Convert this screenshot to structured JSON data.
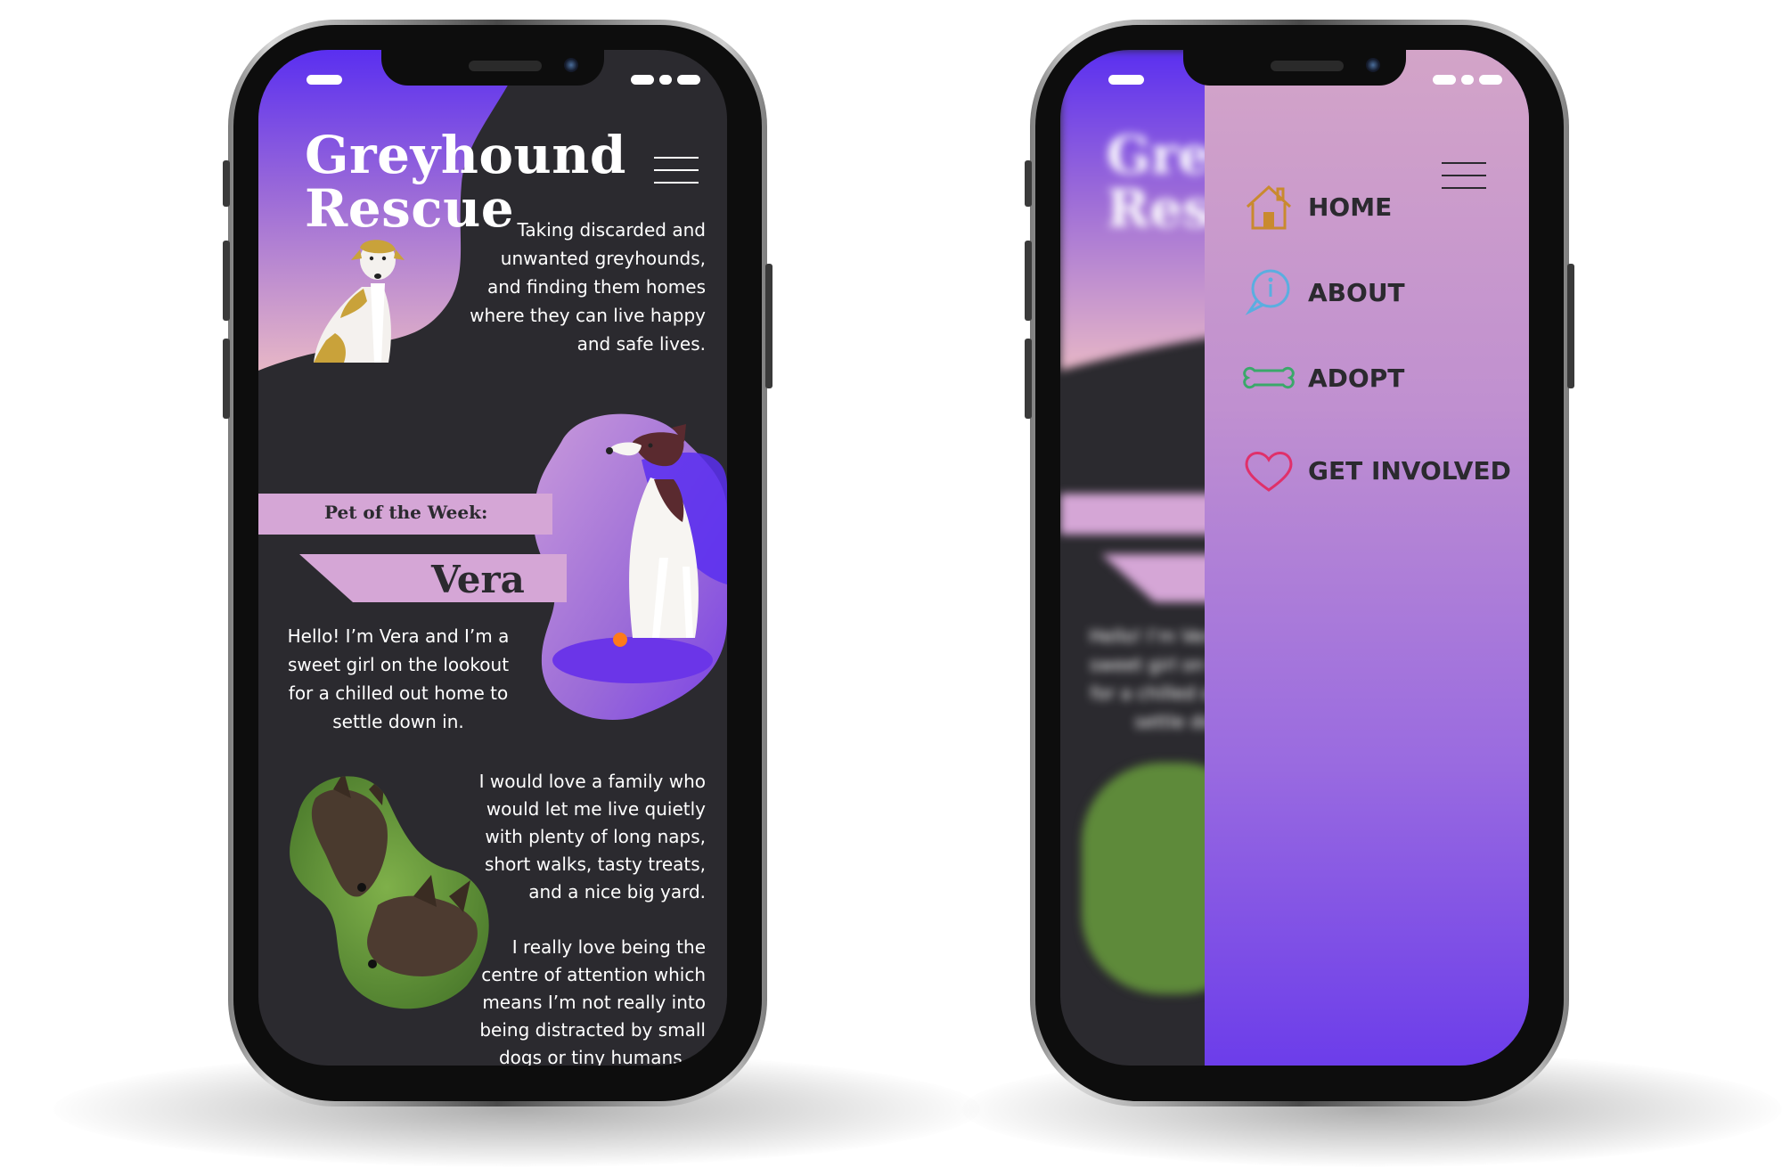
{
  "site": {
    "title_line1": "Greyhound",
    "title_line2": "Rescue",
    "tagline": [
      "Taking discarded and",
      "unwanted greyhounds,",
      "and finding them homes",
      "where they can live happy",
      "and safe lives."
    ]
  },
  "pet_of_week": {
    "label": "Pet of the Week:",
    "name": "Vera",
    "intro": [
      "Hello! I’m Vera and I’m a",
      "sweet girl on the lookout",
      "for a chilled out home to",
      "settle down in."
    ],
    "para2": [
      "I would love a family who",
      "would let me live quietly",
      "with plenty of long naps,",
      "short walks, tasty treats,",
      "and a nice big yard."
    ],
    "para3": [
      "I really love being the",
      "centre of attention which",
      "means I’m not really into",
      "being distracted by small",
      "dogs or tiny humans…."
    ]
  },
  "menu": {
    "items": [
      {
        "label": "HOME",
        "icon": "house-icon",
        "color": "#c98a2e"
      },
      {
        "label": "ABOUT",
        "icon": "info-bubble-icon",
        "color": "#5aaee0"
      },
      {
        "label": "ADOPT",
        "icon": "bone-icon",
        "color": "#3aa86a"
      },
      {
        "label": "GET INVOLVED",
        "icon": "heart-icon",
        "color": "#e0306a"
      }
    ]
  },
  "colors": {
    "background_dark": "#2b2a2f",
    "accent_violet": "#5a2ff0",
    "accent_pink": "#d5a6d6",
    "menu_gradient_top": "#d3a4c8",
    "menu_gradient_bottom": "#6c3dea"
  }
}
